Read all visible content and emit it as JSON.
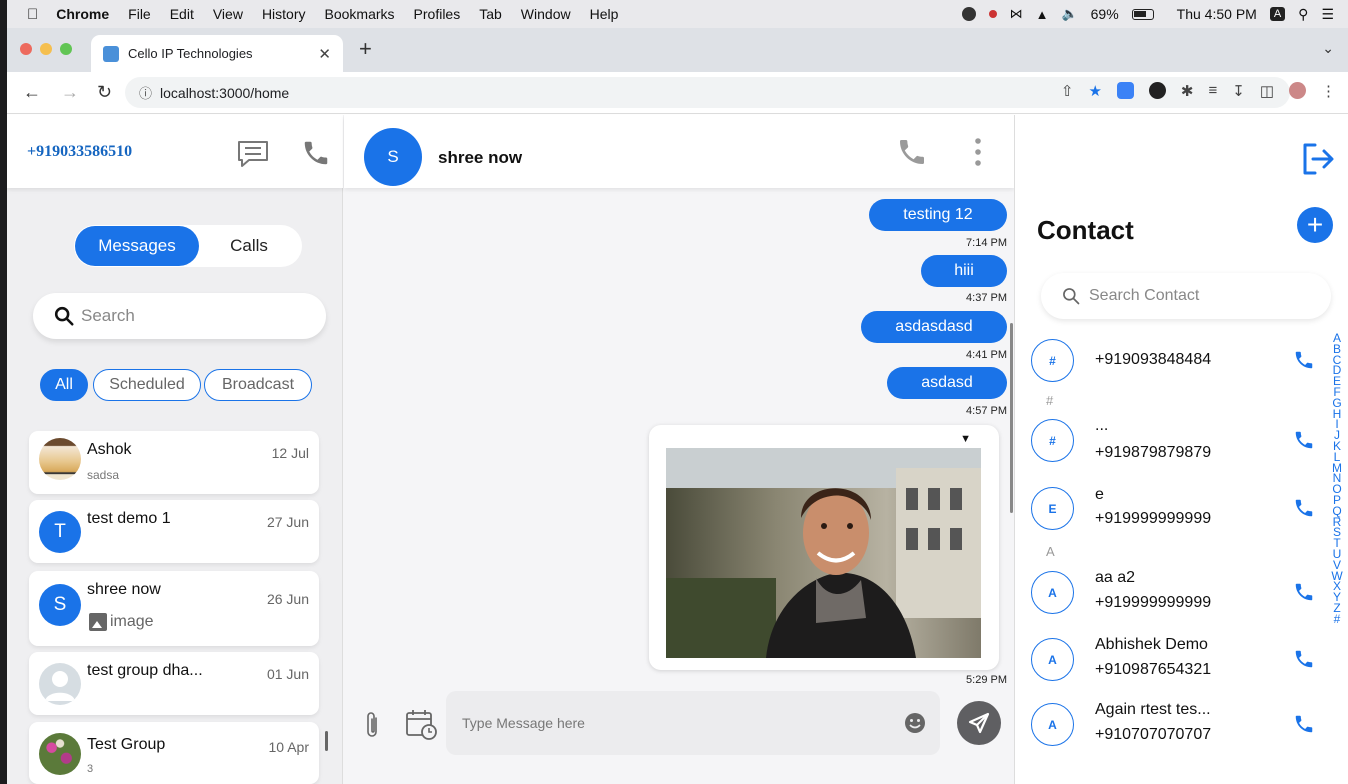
{
  "macbar": {
    "app": "Chrome",
    "menus": [
      "File",
      "Edit",
      "View",
      "History",
      "Bookmarks",
      "Profiles",
      "Tab",
      "Window",
      "Help"
    ],
    "battery": "69%",
    "clock": "Thu 4:50 PM",
    "input_source": "A"
  },
  "browser": {
    "tab_title": "Cello IP Technologies",
    "url": "localhost:3000/home"
  },
  "left": {
    "phone": "+919033586510",
    "toggle": {
      "messages": "Messages",
      "calls": "Calls"
    },
    "search_placeholder": "Search",
    "filters": [
      "All",
      "Scheduled",
      "Broadcast"
    ],
    "conversations": [
      {
        "name": "Ashok",
        "date": "12 Jul",
        "sub": "sadsa",
        "avatar": "photo"
      },
      {
        "name": "test demo 1",
        "date": "27 Jun",
        "sub": "",
        "avatar": "T"
      },
      {
        "name": "shree now",
        "date": "26 Jun",
        "sub": "image",
        "avatar": "S"
      },
      {
        "name": "test group dha...",
        "date": "01 Jun",
        "sub": "",
        "avatar": "person"
      },
      {
        "name": "Test Group",
        "date": "10 Apr",
        "sub": "3",
        "avatar": "flowers"
      }
    ]
  },
  "chat": {
    "avatar_letter": "S",
    "name": "shree now",
    "messages": [
      {
        "text": "testing 12",
        "time": "7:14 PM"
      },
      {
        "text": "hiii",
        "time": "4:37 PM"
      },
      {
        "text": "asdasdasd",
        "time": "4:41 PM"
      },
      {
        "text": "asdasd",
        "time": "4:57 PM"
      }
    ],
    "image_time": "5:29 PM",
    "composer_placeholder": "Type Message here"
  },
  "contacts": {
    "title": "Contact",
    "add_label": "+",
    "search_placeholder": "Search Contact",
    "sections": [
      "#",
      "A"
    ],
    "items": [
      {
        "avatar": "#",
        "line1": "+919093848484",
        "line2": ""
      },
      {
        "avatar": "#",
        "line1": "...",
        "line2": "+919879879879"
      },
      {
        "avatar": "E",
        "line1": "e",
        "line2": "+919999999999"
      },
      {
        "avatar": "A",
        "line1": "aa a2",
        "line2": "+919999999999"
      },
      {
        "avatar": "A",
        "line1": "Abhishek Demo",
        "line2": "+910987654321"
      },
      {
        "avatar": "A",
        "line1": "Again rtest tes...",
        "line2": "+910707070707"
      }
    ],
    "alphabet": [
      "A",
      "B",
      "C",
      "D",
      "E",
      "F",
      "G",
      "H",
      "I",
      "J",
      "K",
      "L",
      "M",
      "N",
      "O",
      "P",
      "Q",
      "R",
      "S",
      "T",
      "U",
      "V",
      "W",
      "X",
      "Y",
      "Z",
      "#"
    ]
  },
  "colors": {
    "accent": "#1a73e8",
    "send": "#5f5f62",
    "phone_number": "#1565c0"
  },
  "icons": [
    "apple-icon",
    "chat-bubble-icon",
    "phone-icon",
    "search-icon",
    "more-vertical-icon",
    "attach-icon",
    "calendar-clock-icon",
    "emoji-icon",
    "send-icon",
    "logout-icon",
    "add-icon"
  ]
}
